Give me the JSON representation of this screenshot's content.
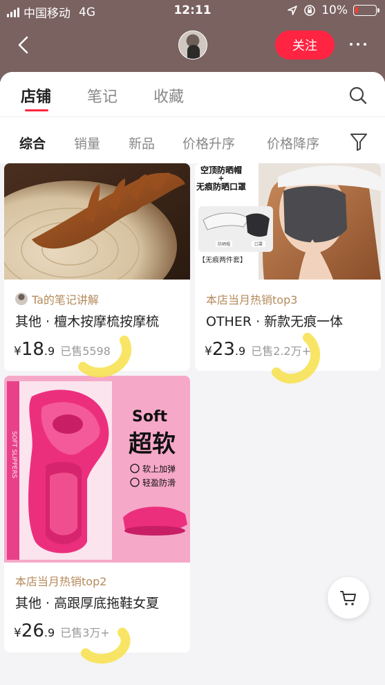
{
  "status_bar": {
    "carrier": "中国移动",
    "network": "4G",
    "time": "12:11",
    "battery": "10%"
  },
  "header": {
    "follow_label": "关注"
  },
  "tabs": [
    {
      "label": "店铺",
      "active": true
    },
    {
      "label": "笔记",
      "active": false
    },
    {
      "label": "收藏",
      "active": false
    }
  ],
  "sort_options": [
    {
      "label": "综合",
      "active": true
    },
    {
      "label": "销量",
      "active": false
    },
    {
      "label": "新品",
      "active": false
    },
    {
      "label": "价格升序",
      "active": false
    },
    {
      "label": "价格降序",
      "active": false
    }
  ],
  "products": [
    {
      "tag": "Ta的笔记讲解",
      "name": "其他 · 檀木按摩梳按摩梳",
      "price_int": "18",
      "price_dec": ".9",
      "sold": "已售5598"
    },
    {
      "tag": "本店当月热销top3",
      "name": "OTHER · 新款无痕一体",
      "price_int": "23",
      "price_dec": ".9",
      "sold": "已售2.2万+",
      "image_text": {
        "line1": "空顶防晒帽",
        "plus": "+",
        "line2": "无痕防晒口罩",
        "label_hat": "防晒帽",
        "label_mask": "口罩",
        "bundle": "【无痕两件套】"
      }
    },
    {
      "tag": "本店当月热销top2",
      "name": "其他 · 高跟厚底拖鞋女夏",
      "price_int": "26",
      "price_dec": ".9",
      "sold": "已售3万+",
      "image_text": {
        "soft": "Soft",
        "big": "超软",
        "feature1": "软上加弹",
        "feature2": "轻盈防滑",
        "box_text": "SOFT SLIPPERS"
      }
    }
  ],
  "currency": "¥",
  "colors": {
    "brand_red": "#ff2442",
    "header_bg": "#7a6261",
    "tag_gold": "#b58a5b",
    "highlight_yellow": "#f7e04a"
  }
}
